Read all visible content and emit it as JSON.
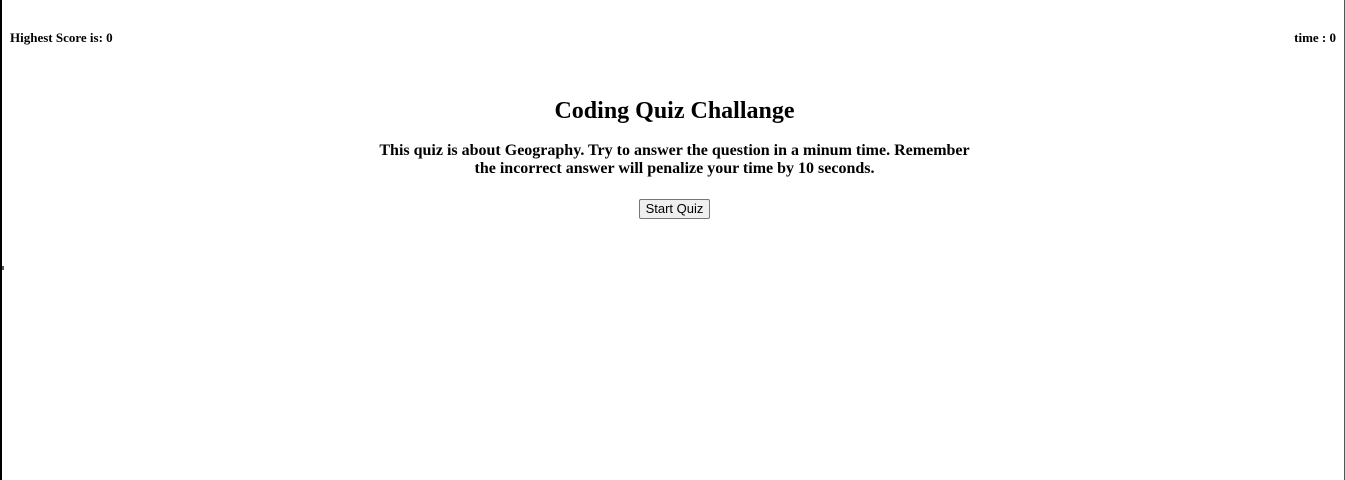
{
  "header": {
    "highest_score": "Highest Score is: 0",
    "timer": "time : 0"
  },
  "intro": {
    "title": "Coding Quiz Challange",
    "description": "This quiz is about Geography. Try to answer the question in a minum time. Remember the incorrect answer will penalize your time by 10 seconds.",
    "start_button_label": "Start Quiz"
  }
}
